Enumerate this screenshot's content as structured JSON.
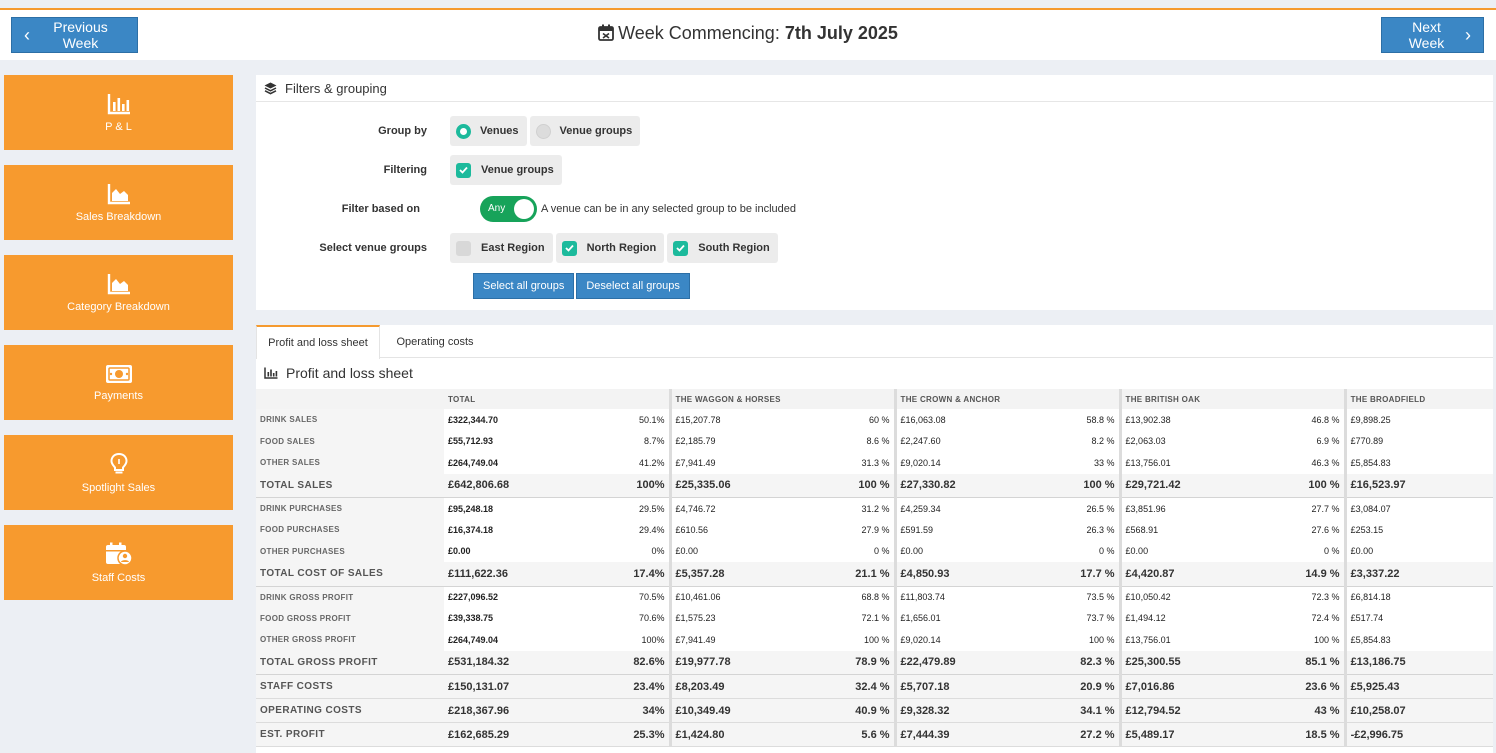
{
  "header": {
    "prev_label": "Previous Week",
    "next_label": "Next Week",
    "title_prefix": "Week Commencing: ",
    "title_date": "7th July 2025"
  },
  "sidebar": {
    "items": [
      {
        "label": "P & L",
        "icon": "bar-chart-icon"
      },
      {
        "label": "Sales Breakdown",
        "icon": "area-chart-icon"
      },
      {
        "label": "Category Breakdown",
        "icon": "area-chart-icon"
      },
      {
        "label": "Payments",
        "icon": "money-icon"
      },
      {
        "label": "Spotlight Sales",
        "icon": "lightbulb-icon"
      },
      {
        "label": "Staff Costs",
        "icon": "calendar-user-icon"
      }
    ]
  },
  "filters": {
    "title": "Filters & grouping",
    "group_by_label": "Group by",
    "group_by_options": [
      "Venues",
      "Venue groups"
    ],
    "group_by_selected": "Venues",
    "filtering_label": "Filtering",
    "filtering_option": "Venue groups",
    "filter_based_label": "Filter based on",
    "toggle_label": "Any",
    "toggle_desc": "A venue can be in any selected group to be included",
    "select_groups_label": "Select venue groups",
    "groups": [
      {
        "name": "East Region",
        "checked": false
      },
      {
        "name": "North Region",
        "checked": true
      },
      {
        "name": "South Region",
        "checked": true
      }
    ],
    "select_all_label": "Select all groups",
    "deselect_all_label": "Deselect all groups"
  },
  "tabs": [
    "Profit and loss sheet",
    "Operating costs"
  ],
  "pl_title": "Profit and loss sheet",
  "table": {
    "columns": [
      "TOTAL",
      "THE WAGGON & HORSES",
      "THE CROWN & ANCHOR",
      "THE BRITISH OAK",
      "THE BROADFIELD"
    ],
    "rows": [
      {
        "label": "DRINK SALES",
        "type": "item",
        "cells": [
          [
            "£322,344.70",
            "50.1%"
          ],
          [
            "£15,207.78",
            "60 %"
          ],
          [
            "£16,063.08",
            "58.8 %"
          ],
          [
            "£13,902.38",
            "46.8 %"
          ],
          [
            "£9,898.25",
            ""
          ]
        ]
      },
      {
        "label": "FOOD SALES",
        "type": "item",
        "cells": [
          [
            "£55,712.93",
            "8.7%"
          ],
          [
            "£2,185.79",
            "8.6 %"
          ],
          [
            "£2,247.60",
            "8.2 %"
          ],
          [
            "£2,063.03",
            "6.9 %"
          ],
          [
            "£770.89",
            ""
          ]
        ]
      },
      {
        "label": "OTHER SALES",
        "type": "item",
        "cells": [
          [
            "£264,749.04",
            "41.2%"
          ],
          [
            "£7,941.49",
            "31.3 %"
          ],
          [
            "£9,020.14",
            "33 %"
          ],
          [
            "£13,756.01",
            "46.3 %"
          ],
          [
            "£5,854.83",
            ""
          ]
        ]
      },
      {
        "label": "TOTAL SALES",
        "type": "total",
        "cells": [
          [
            "£642,806.68",
            "100%"
          ],
          [
            "£25,335.06",
            "100 %"
          ],
          [
            "£27,330.82",
            "100 %"
          ],
          [
            "£29,721.42",
            "100 %"
          ],
          [
            "£16,523.97",
            ""
          ]
        ]
      },
      {
        "label": "DRINK PURCHASES",
        "type": "item",
        "cells": [
          [
            "£95,248.18",
            "29.5%"
          ],
          [
            "£4,746.72",
            "31.2 %"
          ],
          [
            "£4,259.34",
            "26.5 %"
          ],
          [
            "£3,851.96",
            "27.7 %"
          ],
          [
            "£3,084.07",
            ""
          ]
        ]
      },
      {
        "label": "FOOD PURCHASES",
        "type": "item",
        "cells": [
          [
            "£16,374.18",
            "29.4%"
          ],
          [
            "£610.56",
            "27.9 %"
          ],
          [
            "£591.59",
            "26.3 %"
          ],
          [
            "£568.91",
            "27.6 %"
          ],
          [
            "£253.15",
            ""
          ]
        ]
      },
      {
        "label": "OTHER PURCHASES",
        "type": "item",
        "cells": [
          [
            "£0.00",
            "0%"
          ],
          [
            "£0.00",
            "0 %"
          ],
          [
            "£0.00",
            "0 %"
          ],
          [
            "£0.00",
            "0 %"
          ],
          [
            "£0.00",
            ""
          ]
        ]
      },
      {
        "label": "TOTAL COST OF SALES",
        "type": "total",
        "cells": [
          [
            "£111,622.36",
            "17.4%"
          ],
          [
            "£5,357.28",
            "21.1 %"
          ],
          [
            "£4,850.93",
            "17.7 %"
          ],
          [
            "£4,420.87",
            "14.9 %"
          ],
          [
            "£3,337.22",
            ""
          ]
        ]
      },
      {
        "label": "DRINK GROSS PROFIT",
        "type": "item",
        "cells": [
          [
            "£227,096.52",
            "70.5%"
          ],
          [
            "£10,461.06",
            "68.8 %"
          ],
          [
            "£11,803.74",
            "73.5 %"
          ],
          [
            "£10,050.42",
            "72.3 %"
          ],
          [
            "£6,814.18",
            ""
          ]
        ]
      },
      {
        "label": "FOOD GROSS PROFIT",
        "type": "item",
        "cells": [
          [
            "£39,338.75",
            "70.6%"
          ],
          [
            "£1,575.23",
            "72.1 %"
          ],
          [
            "£1,656.01",
            "73.7 %"
          ],
          [
            "£1,494.12",
            "72.4 %"
          ],
          [
            "£517.74",
            ""
          ]
        ]
      },
      {
        "label": "OTHER GROSS PROFIT",
        "type": "item",
        "cells": [
          [
            "£264,749.04",
            "100%"
          ],
          [
            "£7,941.49",
            "100 %"
          ],
          [
            "£9,020.14",
            "100 %"
          ],
          [
            "£13,756.01",
            "100 %"
          ],
          [
            "£5,854.83",
            ""
          ]
        ]
      },
      {
        "label": "TOTAL GROSS PROFIT",
        "type": "total",
        "cells": [
          [
            "£531,184.32",
            "82.6%"
          ],
          [
            "£19,977.78",
            "78.9 %"
          ],
          [
            "£22,479.89",
            "82.3 %"
          ],
          [
            "£25,300.55",
            "85.1 %"
          ],
          [
            "£13,186.75",
            ""
          ]
        ]
      },
      {
        "label": "STAFF COSTS",
        "type": "total",
        "cells": [
          [
            "£150,131.07",
            "23.4%"
          ],
          [
            "£8,203.49",
            "32.4 %"
          ],
          [
            "£5,707.18",
            "20.9 %"
          ],
          [
            "£7,016.86",
            "23.6 %"
          ],
          [
            "£5,925.43",
            ""
          ]
        ]
      },
      {
        "label": "OPERATING COSTS",
        "type": "total",
        "cells": [
          [
            "£218,367.96",
            "34%"
          ],
          [
            "£10,349.49",
            "40.9 %"
          ],
          [
            "£9,328.32",
            "34.1 %"
          ],
          [
            "£12,794.52",
            "43 %"
          ],
          [
            "£10,258.07",
            ""
          ]
        ]
      },
      {
        "label": "EST. PROFIT",
        "type": "total",
        "cells": [
          [
            "£162,685.29",
            "25.3%"
          ],
          [
            "£1,424.80",
            "5.6 %"
          ],
          [
            "£7,444.39",
            "27.2 %"
          ],
          [
            "£5,489.17",
            "18.5 %"
          ],
          [
            "-£2,996.75",
            ""
          ]
        ]
      }
    ]
  },
  "colors": {
    "accent": "#f79a2e",
    "primary": "#3b87c5",
    "check": "#1cba9c",
    "toggle": "#17a35a",
    "negative": "#e14b4b"
  }
}
